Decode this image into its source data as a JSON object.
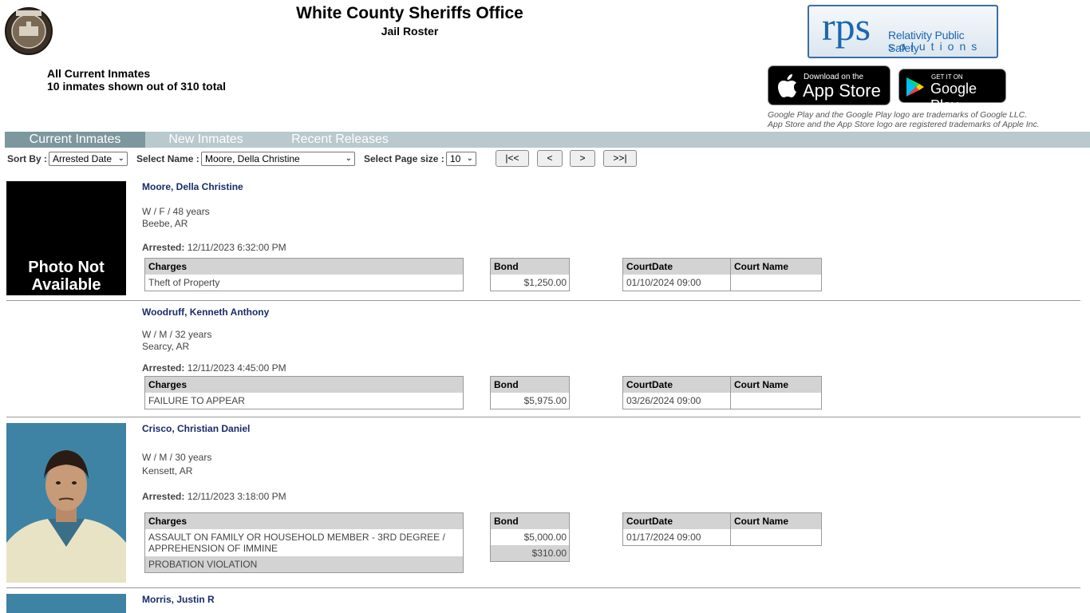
{
  "header": {
    "title": "White County Sheriffs Office",
    "subtitle": "Jail Roster",
    "summary_line1": "All Current Inmates",
    "summary_line2": "10 inmates shown out of 310 total"
  },
  "branding": {
    "rps_big": "rps",
    "rps_line1": "Relativity Public Safety",
    "rps_line2": "solutions",
    "appstore_small": "Download on the",
    "appstore_big": "App Store",
    "gplay_small": "GET IT ON",
    "gplay_big": "Google Play",
    "trademark1": "Google Play and the Google Play logo are trademarks of Google LLC.",
    "trademark2": "App Store and the App Store logo are registered trademarks of Apple Inc."
  },
  "nav": {
    "tabs": [
      "Current Inmates",
      "New Inmates",
      "Recent Releases"
    ],
    "active": 0
  },
  "controls": {
    "sort_label": "Sort By :",
    "sort_value": "Arrested Date",
    "name_label": "Select Name :",
    "name_value": "Moore, Della Christine",
    "page_label": "Select Page size :",
    "page_value": "10",
    "first": "|<<",
    "prev": "<",
    "next": ">",
    "last": ">>|"
  },
  "table_labels": {
    "charges": "Charges",
    "bond": "Bond",
    "court_date": "CourtDate",
    "court_name": "Court Name",
    "arrested": "Arrested:",
    "photo_na_1": "Photo Not",
    "photo_na_2": "Available"
  },
  "inmates": [
    {
      "name": "Moore, Della Christine",
      "demographics": "W / F / 48 years",
      "location": "Beebe, AR",
      "arrested": "12/11/2023 6:32:00 PM",
      "charges": [
        "Theft of Property"
      ],
      "bonds": [
        "$1,250.00"
      ],
      "court_date": "01/10/2024 09:00",
      "court_name": ""
    },
    {
      "name": "Woodruff, Kenneth Anthony",
      "demographics": "W / M / 32 years",
      "location": "Searcy, AR",
      "arrested": "12/11/2023 4:45:00 PM",
      "charges": [
        "FAILURE TO APPEAR"
      ],
      "bonds": [
        "$5,975.00"
      ],
      "court_date": "03/26/2024 09:00",
      "court_name": ""
    },
    {
      "name": "Crisco, Christian Daniel",
      "demographics": "W / M / 30 years",
      "location": "Kensett, AR",
      "arrested": "12/11/2023 3:18:00 PM",
      "charges": [
        "ASSAULT ON FAMILY OR HOUSEHOLD MEMBER - 3RD DEGREE / APPREHENSION OF IMMINE",
        "PROBATION VIOLATION"
      ],
      "bonds": [
        "$5,000.00",
        "$310.00"
      ],
      "court_date": "01/17/2024 09:00",
      "court_name": ""
    },
    {
      "name": "Morris, Justin R"
    }
  ]
}
